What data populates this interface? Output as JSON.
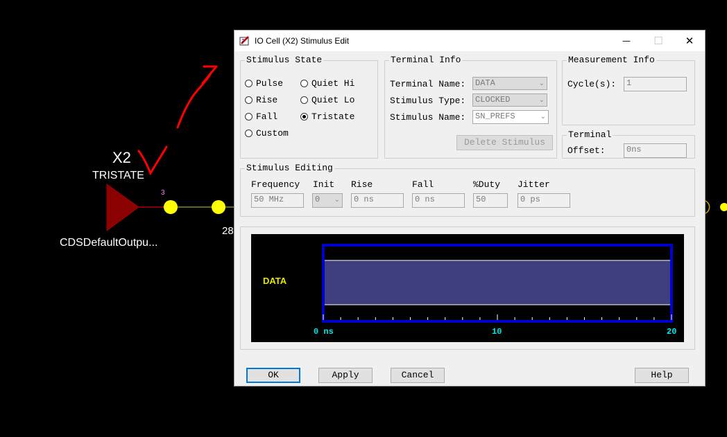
{
  "schematic": {
    "instance_name": "X2",
    "state_label": "TRISTATE",
    "component_label": "CDSDefaultOutpu...",
    "pin_number": "3",
    "partial_number": "28",
    "colors": {
      "triangle": "#8b0000",
      "node": "#ffff00",
      "wire": "#c8c864",
      "annotation": "#ff0000"
    }
  },
  "dialog": {
    "title": "IO Cell (X2) Stimulus Edit",
    "window_buttons": {
      "minimize": "—",
      "maximize": "☐",
      "close": "✕"
    },
    "stimulus_state": {
      "label": "Stimulus State",
      "options": [
        {
          "label": "Pulse",
          "selected": false
        },
        {
          "label": "Rise",
          "selected": false
        },
        {
          "label": "Fall",
          "selected": false
        },
        {
          "label": "Custom",
          "selected": false
        },
        {
          "label": "Quiet Hi",
          "selected": false
        },
        {
          "label": "Quiet Lo",
          "selected": false
        },
        {
          "label": "Tristate",
          "selected": true
        }
      ]
    },
    "terminal_info": {
      "label": "Terminal Info",
      "terminal_name_label": "Terminal Name:",
      "terminal_name_value": "DATA",
      "stimulus_type_label": "Stimulus Type:",
      "stimulus_type_value": "CLOCKED",
      "stimulus_name_label": "Stimulus Name:",
      "stimulus_name_value": "SN_PREFS",
      "delete_button": "Delete Stimulus"
    },
    "measurement_info": {
      "label": "Measurement Info",
      "cycles_label": "Cycle(s):",
      "cycles_value": "1"
    },
    "terminal": {
      "label": "Terminal",
      "offset_label": "Offset:",
      "offset_value": "0ns"
    },
    "stimulus_editing": {
      "label": "Stimulus Editing",
      "frequency_label": "Frequency",
      "frequency_value": "50 MHz",
      "init_label": "Init",
      "init_value": "0",
      "rise_label": "Rise",
      "rise_value": "0 ns",
      "fall_label": "Fall",
      "fall_value": "0 ns",
      "duty_label": "%Duty",
      "duty_value": "50",
      "jitter_label": "Jitter",
      "jitter_value": "0 ps"
    },
    "waveform": {
      "signal_label": "DATA",
      "axis_labels": [
        "0 ns",
        "10",
        "20"
      ],
      "colors": {
        "background": "#000000",
        "frame": "#0000cc",
        "fill": "#3f3f80",
        "label": "#e6e600",
        "axis_label": "#00e6e6"
      }
    },
    "buttons": {
      "ok": "OK",
      "apply": "Apply",
      "cancel": "Cancel",
      "help": "Help"
    }
  }
}
